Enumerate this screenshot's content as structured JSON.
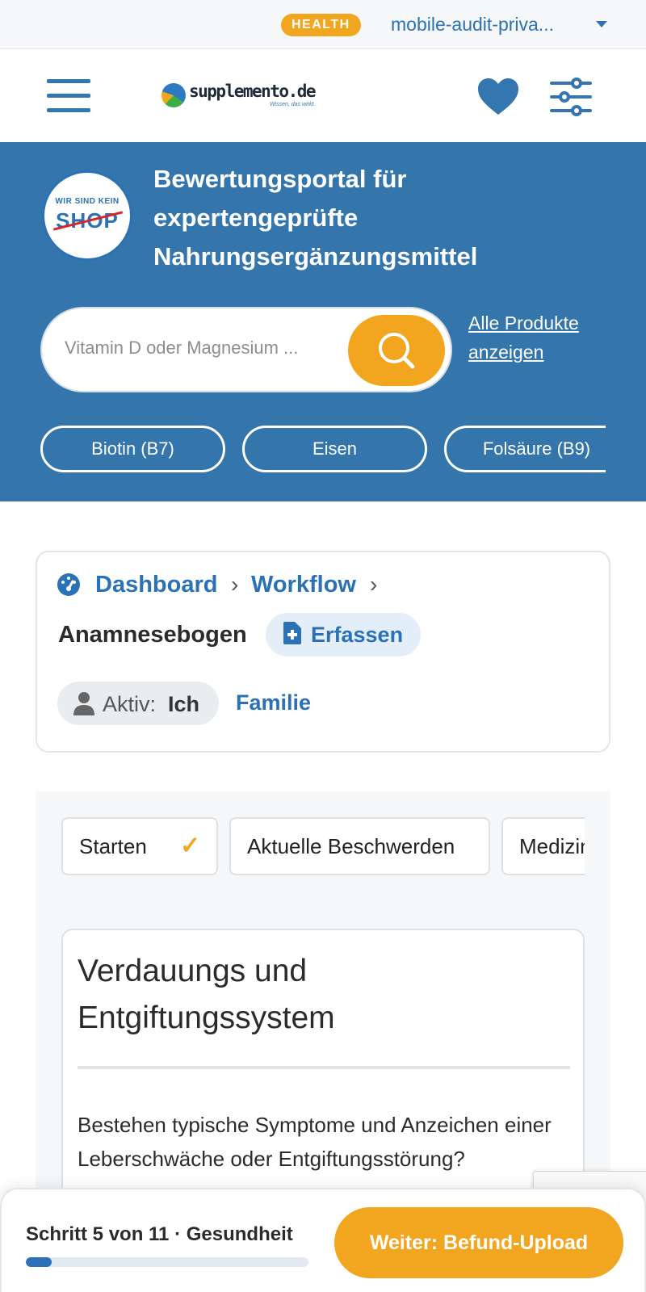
{
  "topbar": {
    "badge": "HEALTH",
    "account": "mobile-audit-priva..."
  },
  "header": {
    "logo_text": "supplemento.de",
    "logo_tagline": "Wissen, das wirkt."
  },
  "hero": {
    "badge_top": "WIR SIND KEIN",
    "badge_main": "SHOP",
    "title": "Bewertungsportal für expertengeprüfte Nahrungsergänzungsmittel",
    "search_placeholder": "Vitamin D oder Magnesium ...",
    "all_products": "Alle Produkte anzeigen",
    "chips": [
      "Biotin (B7)",
      "Eisen",
      "Folsäure (B9)"
    ]
  },
  "breadcrumb": {
    "items": [
      "Dashboard",
      "Workflow"
    ],
    "separator": "›",
    "current": "Anamnesebogen",
    "action": "Erfassen",
    "active_label": "Aktiv:",
    "active_value": "Ich",
    "family": "Familie"
  },
  "workflow": {
    "tabs": [
      {
        "label": "Starten",
        "done": true
      },
      {
        "label": "Aktuelle Beschwerden",
        "done": false
      },
      {
        "label": "Medizinische",
        "done": false
      }
    ],
    "section_title": "Verdauungs und Entgiftungssystem",
    "question": "Bestehen typische Symptome und Anzeichen einer Leberschwäche oder Entgiftungsstörung?"
  },
  "footer": {
    "step_text": "Schritt 5 von 11 · Gesundheit",
    "progress": 0.09,
    "next_label": "Weiter: Befund-Upload"
  },
  "colors": {
    "brand_blue": "#3476ab",
    "link_blue": "#2a72b5",
    "accent_orange": "#f2a51e"
  },
  "icons": [
    "menu-icon",
    "heart-icon",
    "sliders-icon",
    "search-icon",
    "dashboard-icon",
    "file-plus-icon",
    "user-icon",
    "check-icon"
  ]
}
